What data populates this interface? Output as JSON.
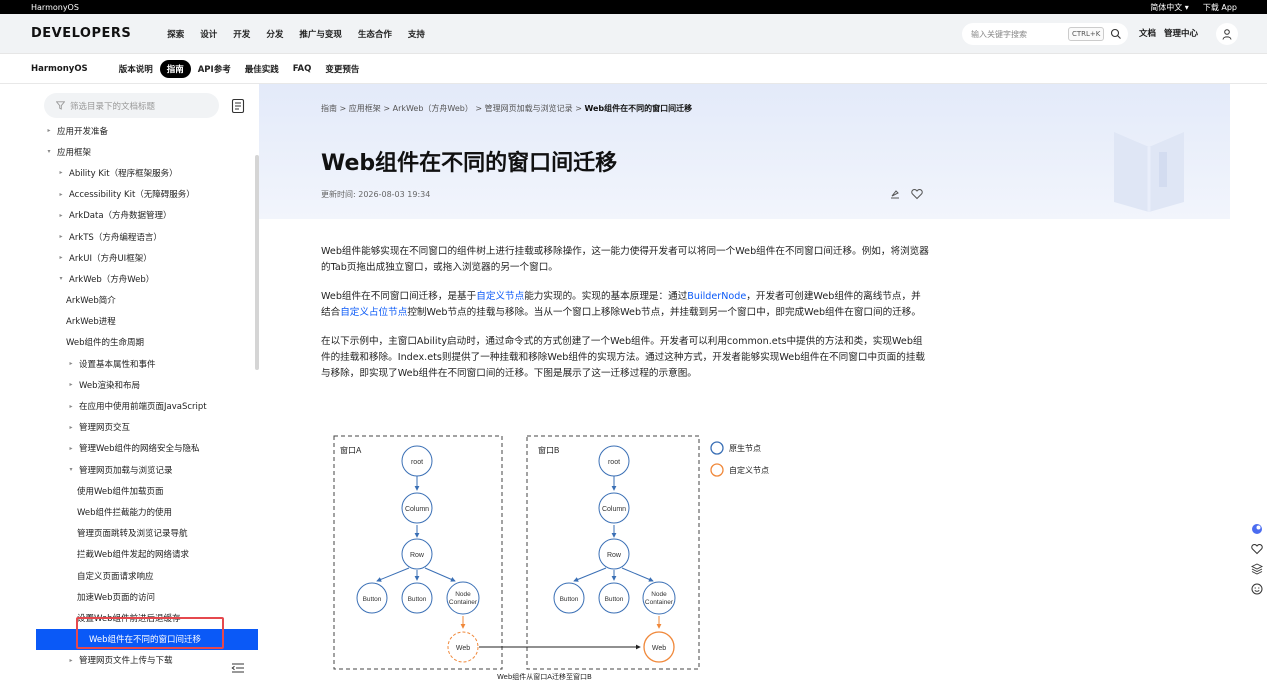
{
  "topbar": {
    "brand": "HarmonyOS",
    "lang": "简体中文 ▾",
    "download": "下载 App"
  },
  "header": {
    "brand": "DEVELOPERS",
    "nav": [
      "探索",
      "设计",
      "开发",
      "分发",
      "推广与变现",
      "生态合作",
      "支持"
    ],
    "search_placeholder": "输入关键字搜索",
    "shortcut": "CTRL+K",
    "links": [
      "文档",
      "管理中心"
    ]
  },
  "subnav": {
    "product": "HarmonyOS",
    "items": [
      "版本说明",
      "指南",
      "API参考",
      "最佳实践",
      "FAQ",
      "变更预告"
    ],
    "active_index": 1
  },
  "sidebar": {
    "filter_placeholder": "筛选目录下的文档标题",
    "items": [
      {
        "label": "应用开发准备",
        "level": 0,
        "arrow": "▸"
      },
      {
        "label": "应用框架",
        "level": 0,
        "arrow": "▾"
      },
      {
        "label": "Ability Kit（程序框架服务）",
        "level": 1,
        "arrow": "▸"
      },
      {
        "label": "Accessibility Kit（无障碍服务）",
        "level": 1,
        "arrow": "▸"
      },
      {
        "label": "ArkData（方舟数据管理）",
        "level": 1,
        "arrow": "▸"
      },
      {
        "label": "ArkTS（方舟编程语言）",
        "level": 1,
        "arrow": "▸"
      },
      {
        "label": "ArkUI（方舟UI框架）",
        "level": 1,
        "arrow": "▸"
      },
      {
        "label": "ArkWeb（方舟Web）",
        "level": 1,
        "arrow": "▾"
      },
      {
        "label": "ArkWeb简介",
        "level": 2,
        "arrow": ""
      },
      {
        "label": "ArkWeb进程",
        "level": 2,
        "arrow": ""
      },
      {
        "label": "Web组件的生命周期",
        "level": 2,
        "arrow": ""
      },
      {
        "label": "设置基本属性和事件",
        "level": 2,
        "arrow": "▸"
      },
      {
        "label": "Web渲染和布局",
        "level": 2,
        "arrow": "▸"
      },
      {
        "label": "在应用中使用前端页面JavaScript",
        "level": 2,
        "arrow": "▸"
      },
      {
        "label": "管理网页交互",
        "level": 2,
        "arrow": "▸"
      },
      {
        "label": "管理Web组件的网络安全与隐私",
        "level": 2,
        "arrow": "▸"
      },
      {
        "label": "管理网页加载与浏览记录",
        "level": 2,
        "arrow": "▾"
      },
      {
        "label": "使用Web组件加载页面",
        "level": 3,
        "arrow": ""
      },
      {
        "label": "Web组件拦截能力的使用",
        "level": 3,
        "arrow": ""
      },
      {
        "label": "管理页面跳转及浏览记录导航",
        "level": 3,
        "arrow": ""
      },
      {
        "label": "拦截Web组件发起的网络请求",
        "level": 3,
        "arrow": ""
      },
      {
        "label": "自定义页面请求响应",
        "level": 3,
        "arrow": ""
      },
      {
        "label": "加速Web页面的访问",
        "level": 3,
        "arrow": ""
      },
      {
        "label": "设置Web组件前进后退缓存",
        "level": 3,
        "arrow": ""
      },
      {
        "label": "Web组件在不同的窗口间迁移",
        "level": 3,
        "arrow": "",
        "selected": true
      },
      {
        "label": "管理网页文件上传与下载",
        "level": 2,
        "arrow": "▸"
      }
    ]
  },
  "content": {
    "breadcrumb": [
      "指南",
      "应用框架",
      "ArkWeb（方舟Web）",
      "管理网页加载与浏览记录",
      "Web组件在不同的窗口间迁移"
    ],
    "title": "Web组件在不同的窗口间迁移",
    "updated": "更新时间: 2026-08-03 19:34",
    "p1": "Web组件能够实现在不同窗口的组件树上进行挂载或移除操作，这一能力使得开发者可以将同一个Web组件在不同窗口间迁移。例如，将浏览器的Tab页拖出成独立窗口，或拖入浏览器的另一个窗口。",
    "p2_a": "Web组件在不同窗口间迁移，是基于",
    "p2_link1": "自定义节点",
    "p2_b": "能力实现的。实现的基本原理是：通过",
    "p2_link2": "BuilderNode",
    "p2_c": "，开发者可创建Web组件的离线节点，并结合",
    "p2_link3": "自定义占位节点",
    "p2_d": "控制Web节点的挂载与移除。当从一个窗口上移除Web节点，并挂载到另一个窗口中，即完成Web组件在窗口间的迁移。",
    "p3": "在以下示例中，主窗口Ability启动时，通过命令式的方式创建了一个Web组件。开发者可以利用common.ets中提供的方法和类，实现Web组件的挂载和移除。Index.ets则提供了一种挂载和移除Web组件的实现方法。通过这种方式，开发者能够实现Web组件在不同窗口中页面的挂载与移除，即实现了Web组件在不同窗口间的迁移。下图是展示了这一迁移过程的示意图。"
  },
  "diagram": {
    "window_a": "窗口A",
    "window_b": "窗口B",
    "legend_native": "原生节点",
    "legend_custom": "自定义节点",
    "root": "root",
    "column": "Column",
    "row": "Row",
    "button": "Button",
    "node": "Node",
    "container": "Container",
    "web": "Web",
    "caption": "Web组件从窗口A迁移至窗口B",
    "native_color": "#3a6fb5",
    "custom_color": "#f0883a"
  }
}
